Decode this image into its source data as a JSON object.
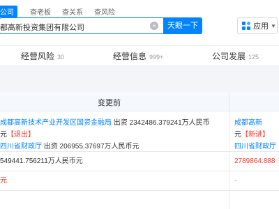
{
  "top_tabs": [
    "公司",
    "查老板",
    "查关系",
    "查风险"
  ],
  "search": {
    "value": "都高新投资集团有限公司",
    "button_label": "天眼一下"
  },
  "app_button": {
    "label": "应用"
  },
  "nav": [
    {
      "label": "经营风险",
      "count": "30"
    },
    {
      "label": "经营信息",
      "count": "999+"
    },
    {
      "label": "公司发展",
      "count": "125"
    }
  ],
  "table": {
    "header_before": "变更前",
    "row1": {
      "left": {
        "entity1": "成都高新技术产业开发区国资金融局",
        "amount1": " 出资 2342486.379241万人民币",
        "line2_prefix": "元",
        "tag1": "【退出】",
        "entity2": "四川省财政厅",
        "amount2": " 出资 206955.37697万人民币元"
      },
      "right": {
        "entity1": "成都高新",
        "line2_prefix": "元",
        "tag1": "【新进】",
        "entity2": "四川省财政厅"
      }
    },
    "row2": {
      "left": "549441.756211万人民币元",
      "right": "2789864.888"
    },
    "row3": {
      "left": "元",
      "right": "-"
    }
  },
  "colors": {
    "accent": "#0084ff",
    "exit_red": "#f04134",
    "band": "#f3f5f8"
  }
}
